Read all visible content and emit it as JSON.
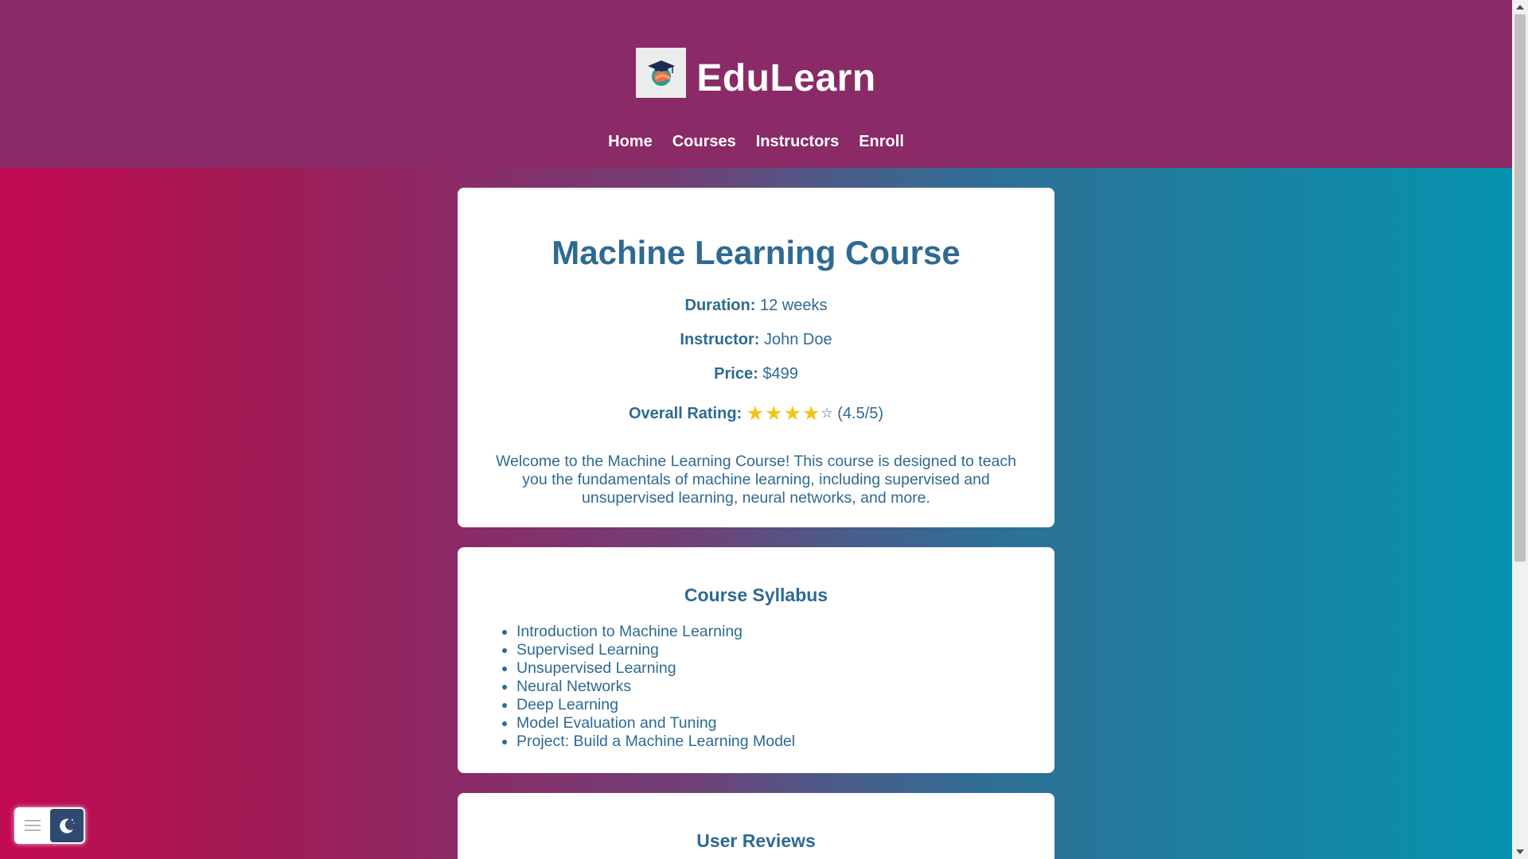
{
  "header": {
    "brand_name": "EduLearn",
    "nav": [
      "Home",
      "Courses",
      "Instructors",
      "Enroll"
    ]
  },
  "course": {
    "title": "Machine Learning Course",
    "duration_label": "Duration:",
    "duration_value": "12 weeks",
    "instructor_label": "Instructor:",
    "instructor_value": "John Doe",
    "price_label": "Price:",
    "price_value": "$499",
    "rating_label": "Overall Rating:",
    "rating_stars_filled": "★★★★",
    "rating_star_empty": "☆",
    "rating_value": 4.5,
    "rating_text": "(4.5/5)",
    "description": "Welcome to the Machine Learning Course! This course is designed to teach you the fundamentals of machine learning, including supervised and unsupervised learning, neural networks, and more."
  },
  "syllabus": {
    "title": "Course Syllabus",
    "items": [
      "Introduction to Machine Learning",
      "Supervised Learning",
      "Unsupervised Learning",
      "Neural Networks",
      "Deep Learning",
      "Model Evaluation and Tuning",
      "Project: Build a Machine Learning Model"
    ]
  },
  "reviews": {
    "title": "User Reviews"
  },
  "widget": {
    "menu_icon": "hamburger-icon",
    "theme_icon": "moon-icon"
  },
  "colors": {
    "header_bg": "#8a2a66",
    "text_primary": "#2e6a92",
    "star": "#f4c518",
    "gradient_left": "#c40a55",
    "gradient_right": "#0494b0"
  }
}
